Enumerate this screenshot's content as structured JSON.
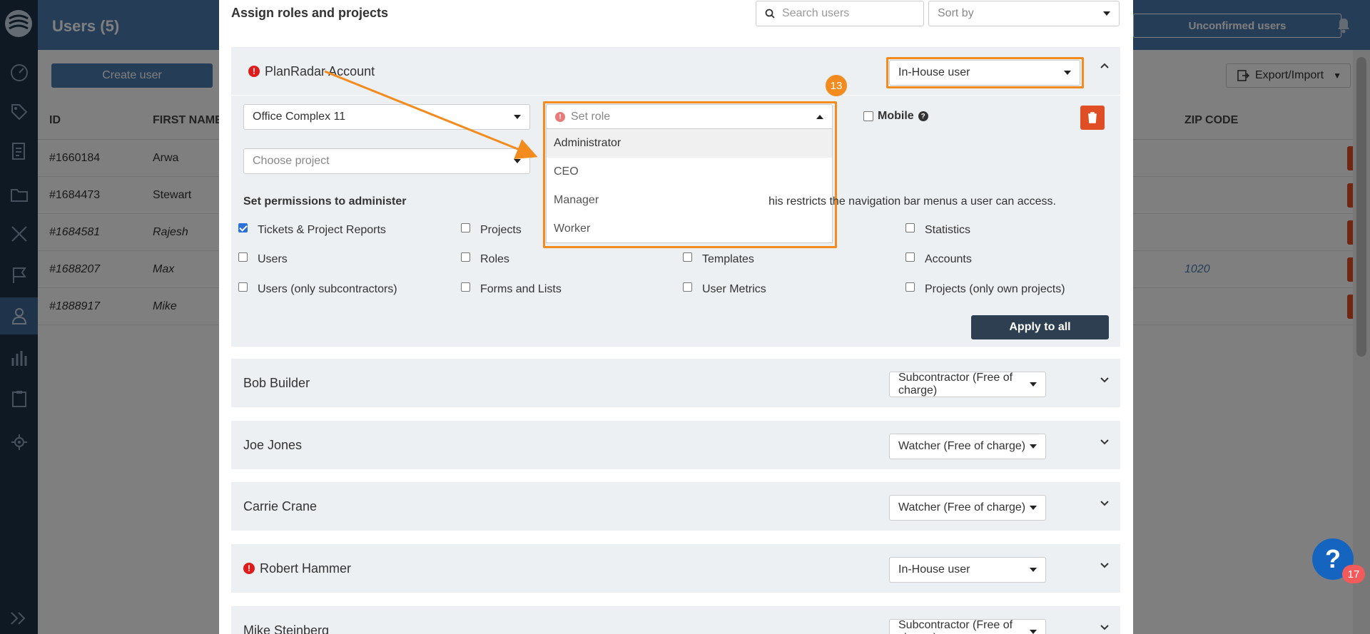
{
  "app": {
    "page_title": "Users (5)",
    "unconfirmed_label": "Unconfirmed users",
    "create_user_label": "Create user",
    "export_label": "Export/Import",
    "columns": {
      "id": "ID",
      "first_name": "FIRST NAME",
      "zip_code": "ZIP CODE"
    },
    "rows": [
      {
        "id": "#1660184",
        "first_name": "Arwa",
        "zip": ""
      },
      {
        "id": "#1684473",
        "first_name": "Stewart",
        "zip": ""
      },
      {
        "id": "#1684581",
        "first_name": "Rajesh",
        "zip": ""
      },
      {
        "id": "#1688207",
        "first_name": "Max",
        "zip": "1020"
      },
      {
        "id": "#1888917",
        "first_name": "Mike",
        "zip": ""
      }
    ]
  },
  "modal": {
    "title": "Assign roles and projects",
    "search_placeholder": "Search users",
    "sort_placeholder": "Sort by",
    "account": {
      "name": "PlanRadar Account",
      "user_type": "In-House user",
      "project_value": "Office Complex 11",
      "role_placeholder": "Set role",
      "project_placeholder": "Choose project",
      "mobile_label": "Mobile",
      "step_number": "13",
      "role_options": [
        "Administrator",
        "CEO",
        "Manager",
        "Worker"
      ],
      "permissions_title": "Set permissions to administer",
      "permissions_note": "his restricts the navigation bar menus a user can access.",
      "permissions": [
        {
          "label": "Tickets & Project Reports",
          "checked": true
        },
        {
          "label": "Projects",
          "checked": false
        },
        {
          "label": "Statistics",
          "checked": false
        },
        {
          "label": "Users",
          "checked": false
        },
        {
          "label": "Roles",
          "checked": false
        },
        {
          "label": "Templates",
          "checked": false
        },
        {
          "label": "Accounts",
          "checked": false
        },
        {
          "label": "Users (only subcontractors)",
          "checked": false
        },
        {
          "label": "Forms and Lists",
          "checked": false
        },
        {
          "label": "User Metrics",
          "checked": false
        },
        {
          "label": "Projects (only own projects)",
          "checked": false
        }
      ],
      "apply_label": "Apply to all"
    },
    "users": [
      {
        "name": "Bob Builder",
        "type": "Subcontractor (Free of charge)",
        "warning": false
      },
      {
        "name": "Joe Jones",
        "type": "Watcher (Free of charge)",
        "warning": false
      },
      {
        "name": "Carrie Crane",
        "type": "Watcher (Free of charge)",
        "warning": false
      },
      {
        "name": "Robert Hammer",
        "type": "In-House user",
        "warning": true
      },
      {
        "name": "Mike Steinberg",
        "type": "Subcontractor (Free of charge)",
        "warning": false
      }
    ]
  },
  "help": {
    "label": "?",
    "count": "17"
  },
  "colors": {
    "accent": "#f38b1e",
    "primary": "#4d7bb0",
    "danger": "#e04e25",
    "sidebar": "#1f3247"
  }
}
